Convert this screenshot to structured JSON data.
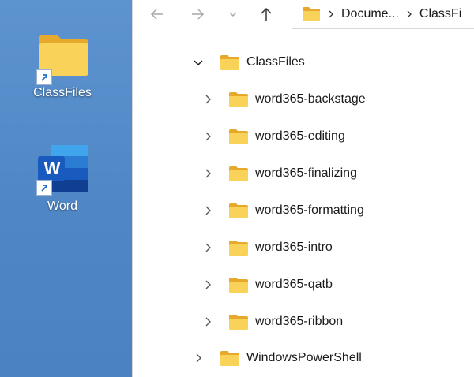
{
  "desktop": {
    "icons": [
      {
        "label": "ClassFiles",
        "icon": "folder-shortcut-icon"
      },
      {
        "label": "Word",
        "icon": "word-shortcut-icon",
        "letter": "W"
      }
    ]
  },
  "explorer": {
    "nav": {
      "back": "arrow-left-icon",
      "forward": "arrow-right-icon",
      "recent": "chevron-down-icon",
      "up": "arrow-up-icon"
    },
    "address": {
      "crumbs": [
        "Docume...",
        "ClassFi"
      ]
    },
    "tree": {
      "root": {
        "label": "ClassFiles",
        "expanded": true
      },
      "children": [
        {
          "label": "word365-backstage"
        },
        {
          "label": "word365-editing"
        },
        {
          "label": "word365-finalizing"
        },
        {
          "label": "word365-formatting"
        },
        {
          "label": "word365-intro"
        },
        {
          "label": "word365-qatb"
        },
        {
          "label": "word365-ribbon"
        }
      ],
      "sibling": {
        "label": "WindowsPowerShell",
        "expanded": false
      }
    }
  },
  "colors": {
    "desktop": "#4f87c6",
    "folder": "#f7cc45",
    "word_blue": "#185abd",
    "nav_disabled": "#a8a8a8"
  }
}
